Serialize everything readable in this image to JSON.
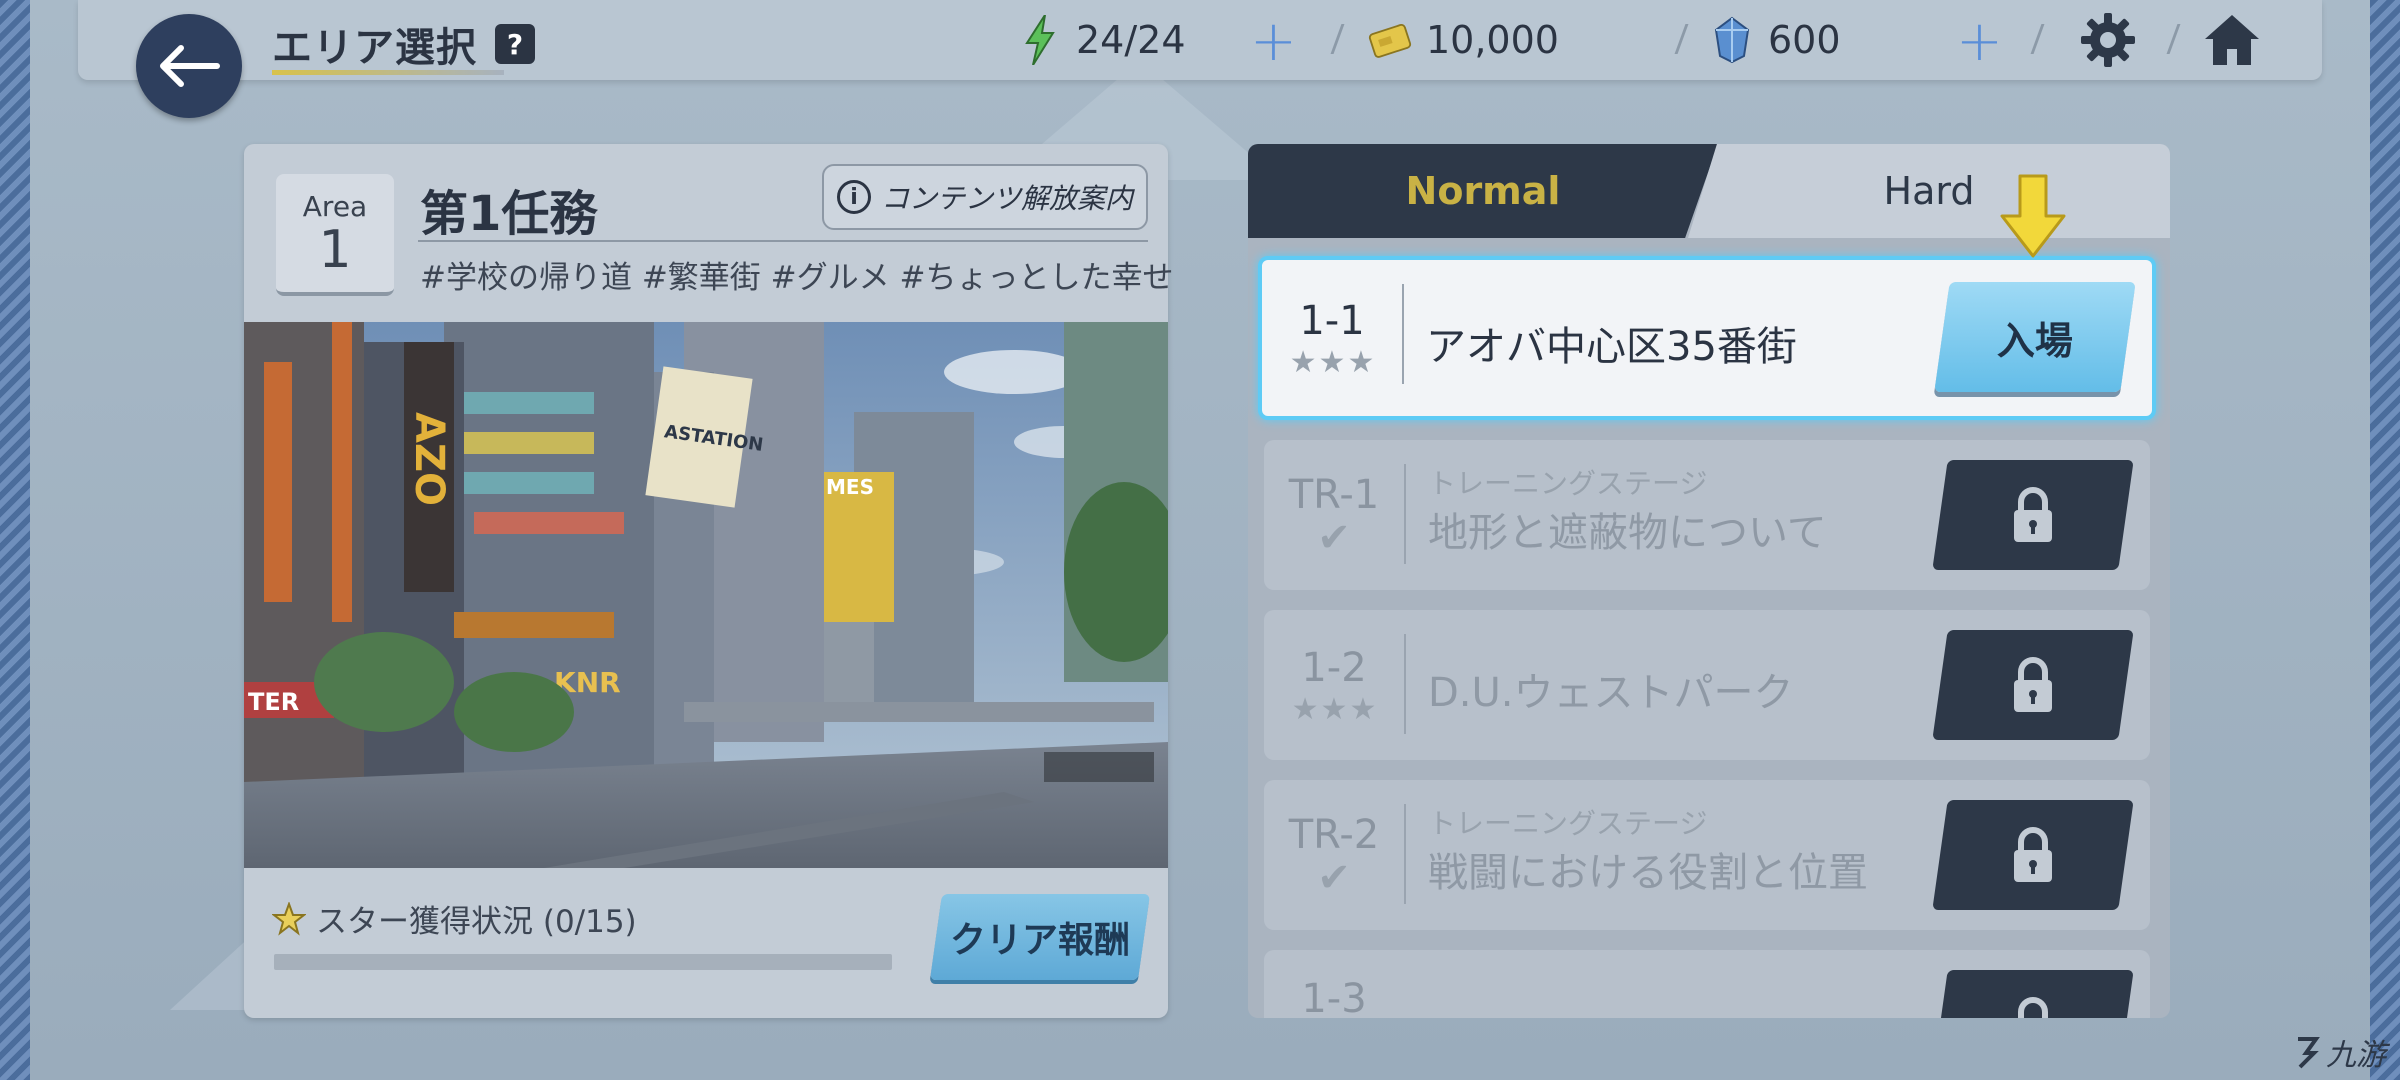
{
  "header": {
    "title": "エリア選択",
    "help": "?",
    "ap": "24/24",
    "credits": "10,000",
    "gems": "600"
  },
  "area": {
    "label": "Area",
    "number": "1",
    "title": "第1任務",
    "content_button": "コンテンツ解放案内",
    "tags": "#学校の帰り道 #繁華街 #グルメ #ちょっとした幸せ",
    "scene_signs": [
      "ASTATION",
      "MES",
      "KNR",
      "AZO",
      "TER"
    ],
    "star_status": "スター獲得状況 (0/15)",
    "star_progress": 0,
    "reward_button": "クリア報酬"
  },
  "tabs": {
    "normal": "Normal",
    "hard": "Hard"
  },
  "stages": [
    {
      "code": "1-1",
      "name": "アオバ中心区35番街",
      "type": "stars",
      "state": "open",
      "action": "入場"
    },
    {
      "code": "TR-1",
      "sub": "トレーニングステージ",
      "name": "地形と遮蔽物について",
      "type": "check",
      "state": "locked"
    },
    {
      "code": "1-2",
      "name": "D.U.ウェストパーク",
      "type": "stars",
      "state": "locked"
    },
    {
      "code": "TR-2",
      "sub": "トレーニングステージ",
      "name": "戦闘における役割と位置",
      "type": "check",
      "state": "locked"
    },
    {
      "code": "1-3",
      "name": "",
      "type": "stars",
      "state": "locked"
    }
  ],
  "watermark": "九游"
}
